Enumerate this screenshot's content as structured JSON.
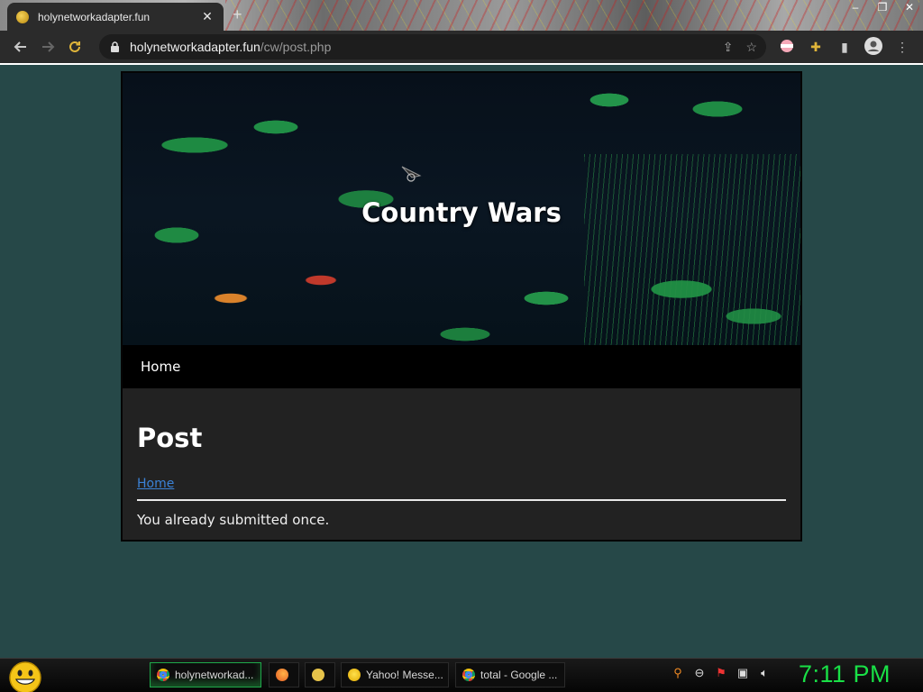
{
  "browser": {
    "tab_title": "holynetworkadapter.fun",
    "tab_close": "✕",
    "new_tab": "+",
    "window_controls": [
      "–",
      "❐",
      "✕"
    ],
    "url_host": "holynetworkadapter.fun",
    "url_path": "/cw/post.php"
  },
  "site": {
    "title": "Country Wars",
    "nav": {
      "home": "Home"
    }
  },
  "page": {
    "heading": "Post",
    "breadcrumb": "Home",
    "message": "You already submitted once."
  },
  "taskbar": {
    "items": [
      {
        "label": "holynetworkad...",
        "icon": "chrome-icon"
      },
      {
        "label": "",
        "icon": "firefox-icon"
      },
      {
        "label": "",
        "icon": "folder-icon"
      },
      {
        "label": "Yahoo! Messe...",
        "icon": "yahoo-messenger-icon"
      },
      {
        "label": "total - Google ...",
        "icon": "chrome-icon"
      }
    ],
    "tray_icons": [
      "search-icon",
      "minus-circle-icon",
      "flag-icon",
      "network-icon",
      "volume-icon"
    ],
    "clock": "7:11 PM"
  },
  "colors": {
    "page_background": "#264848",
    "content_background": "#222222",
    "nav_background": "#000000",
    "link": "#3b82d6",
    "clock": "#19e046"
  }
}
